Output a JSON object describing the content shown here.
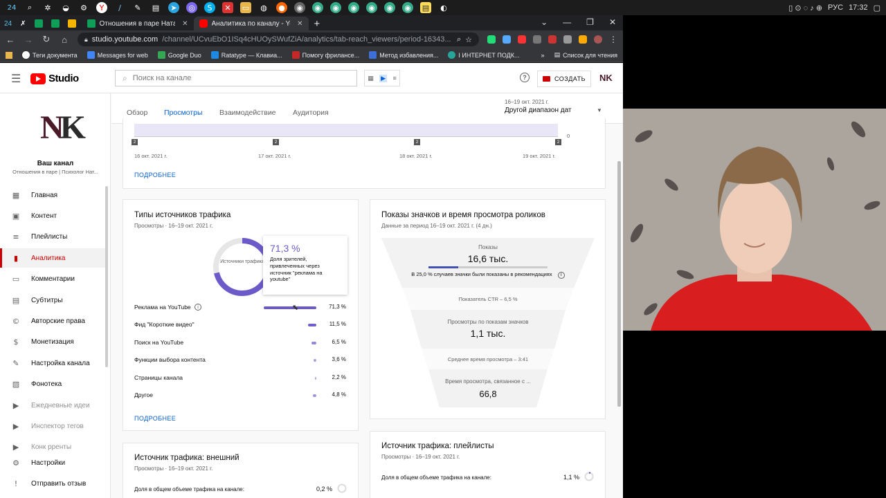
{
  "taskbar": {
    "time": "17:32",
    "lang": "РУС",
    "first_label": "24"
  },
  "browser": {
    "tabs": [
      {
        "label": "Отношения в паре Наталья Кор",
        "active": false
      },
      {
        "label": "Аналитика по каналу - YouTube",
        "active": true
      }
    ],
    "url_host": "studio.youtube.com",
    "url_path": "/channel/UCvuEbO1ISq4cHUOySWufZiA/analytics/tab-reach_viewers/period-16343...",
    "bookmarks": [
      "Теги документа",
      "Messages for web",
      "Google Duo",
      "Ratatype — Клавиа...",
      "Помогу фрилансе...",
      "Метод избавления...",
      "I ИНТЕРНЕТ ПОДК..."
    ],
    "reading_list": "Список для чтения"
  },
  "studio": {
    "logo_text": "Studio",
    "search_placeholder": "Поиск на канале",
    "create_label": "СОЗДАТЬ",
    "avatar_letters": "NK",
    "channel_name": "Ваш канал",
    "channel_sub": "Отношения в паре | Психолог Нат...",
    "nav": [
      {
        "label": "Главная",
        "icon": "dashboard-icon"
      },
      {
        "label": "Контент",
        "icon": "content-icon"
      },
      {
        "label": "Плейлисты",
        "icon": "playlists-icon"
      },
      {
        "label": "Аналитика",
        "icon": "analytics-icon",
        "active": true
      },
      {
        "label": "Комментарии",
        "icon": "comments-icon"
      },
      {
        "label": "Субтитры",
        "icon": "subtitles-icon"
      },
      {
        "label": "Авторские права",
        "icon": "copyright-icon"
      },
      {
        "label": "Монетизация",
        "icon": "monetization-icon"
      },
      {
        "label": "Настройка канала",
        "icon": "customization-icon"
      },
      {
        "label": "Фонотека",
        "icon": "audio-library-icon"
      },
      {
        "label": "Ежедневные идеи",
        "icon": "ideas-icon",
        "dim": true
      },
      {
        "label": "Инспектор тегов",
        "icon": "tags-icon",
        "dim": true
      },
      {
        "label": "Конк рренты",
        "icon": "competitors-icon",
        "dim": true
      }
    ],
    "nav_bottom": [
      {
        "label": "Настройки",
        "icon": "settings-icon"
      },
      {
        "label": "Отправить отзыв",
        "icon": "feedback-icon"
      }
    ],
    "analytics_tabs": [
      "Обзор",
      "Просмотры",
      "Взаимодействие",
      "Аудитория"
    ],
    "active_tab": "Просмотры",
    "date_range_top": "16–19 окт. 2021 г.",
    "date_range_label": "Другой диапазон дат"
  },
  "top_chart": {
    "dates": [
      "16 окт. 2021 г.",
      "17 окт. 2021 г.",
      "18 окт. 2021 г.",
      "19 окт. 2021 г."
    ],
    "marker": "2",
    "zero": "0",
    "more": "ПОДРОБНЕЕ"
  },
  "traffic_types": {
    "title": "Типы источников трафика",
    "subtitle": "Просмотры · 16–19 окт. 2021 г.",
    "donut_center": "Источники трафика",
    "tooltip_value": "71,3 %",
    "tooltip_text": "Доля зрителей, привлеченных через источник \"реклама на youtube\"",
    "accent": "#6c5ac9",
    "more": "ПОДРОБНЕЕ"
  },
  "chart_data": {
    "type": "bar",
    "categories": [
      "Реклама на YouTube",
      "Фид \"Короткие видео\"",
      "Поиск на YouTube",
      "Функции выбора контента",
      "Страницы канала",
      "Другое"
    ],
    "values": [
      71.3,
      11.5,
      6.5,
      3.6,
      2.2,
      4.8
    ],
    "labels": [
      "71,3 %",
      "11,5 %",
      "6,5 %",
      "3,6 %",
      "2,2 %",
      "4,8 %"
    ],
    "title": "",
    "xlabel": "",
    "ylabel": "",
    "ylim": [
      0,
      100
    ]
  },
  "impressions": {
    "title": "Показы значков и время просмотра роликов",
    "subtitle": "Данные за период 16–19 окт. 2021 г. (4 дн.)",
    "impressions_label": "Показы",
    "impressions_value": "16,6 тыс.",
    "recommend_text": "В 25,0 % случаев значки были показаны в рекомендациях",
    "recommend_share": 0.25,
    "ctr_text": "Показатель CTR – 6,5 %",
    "views_label": "Просмотры по показам значков",
    "views_value": "1,1 тыс.",
    "avg_text": "Среднее время просмотра – 3:41",
    "watch_label": "Время просмотра, связанное с ...",
    "watch_value": "66,8"
  },
  "external": {
    "title": "Источник трафика: внешний",
    "subtitle": "Просмотры · 16–19 окт. 2021 г.",
    "share_label": "Доля в общем объеме трафика на канале:",
    "share_value": "0,2 %"
  },
  "playlists": {
    "title": "Источник трафика: плейлисты",
    "subtitle": "Просмотры · 16–19 окт. 2021 г.",
    "share_label": "Доля в общем объеме трафика на канале:",
    "share_value": "1,1 %"
  }
}
